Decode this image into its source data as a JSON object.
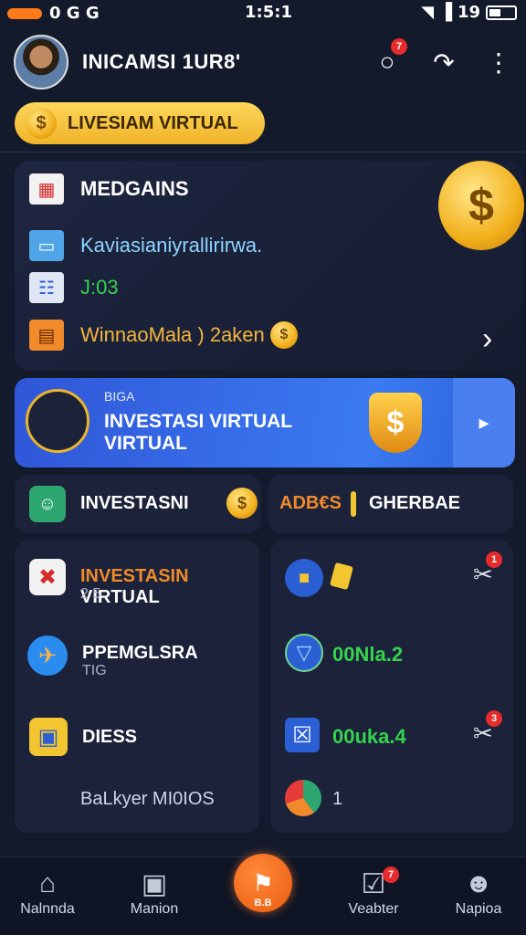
{
  "status_bar": {
    "left_glyphs": "0 G G",
    "time": "1:5:1",
    "battery_text": "19"
  },
  "header": {
    "title": "INICAMSI 1UR8'",
    "notif_badge": "7"
  },
  "pill": {
    "label": "LIVESIAM VIRTUAL",
    "coin_symbol": "$"
  },
  "card": {
    "rows": [
      {
        "icon": "calendar-icon",
        "text": "MEDGAINS"
      },
      {
        "icon": "monitor-icon",
        "text": "Kaviasianiyrallirirwa."
      },
      {
        "icon": "document-icon",
        "text": "J:03"
      },
      {
        "icon": "folder-icon",
        "text": "WinnaoMala ) 2aken"
      }
    ],
    "big_coin": "$"
  },
  "banner": {
    "small": "BIGA",
    "line1": "INVESTASI VIRTUAL",
    "line2": "VIRTUAL",
    "shield_symbol": "$"
  },
  "row1": {
    "left_label": "INVESTASNI",
    "right_orange": "ADB€S",
    "right_label": "GHERBAE"
  },
  "list_left": [
    {
      "title_orange": "INVESTASIN",
      "title_white": " VIRTUAL",
      "sub": "2 5"
    },
    {
      "title": "PPEMGLSRA",
      "sub": "TIG"
    },
    {
      "title": "DIESS",
      "sub": ""
    }
  ],
  "list_right": [
    {
      "value": "",
      "badge": "1"
    },
    {
      "value": "00Nla.2",
      "badge": ""
    },
    {
      "value": "00uka.4",
      "badge": "3"
    }
  ],
  "bottom_left_text": "BaLkyer MI0IOS",
  "bottom_right_text": "1",
  "nav": [
    {
      "label": "Nalnnda",
      "icon": "home-icon"
    },
    {
      "label": "Manion",
      "icon": "robot-icon"
    },
    {
      "label": "B.B",
      "icon": "center-action-icon"
    },
    {
      "label": "Veabter",
      "icon": "checklist-icon",
      "badge": "7"
    },
    {
      "label": "Napioa",
      "icon": "profile-icon"
    }
  ]
}
